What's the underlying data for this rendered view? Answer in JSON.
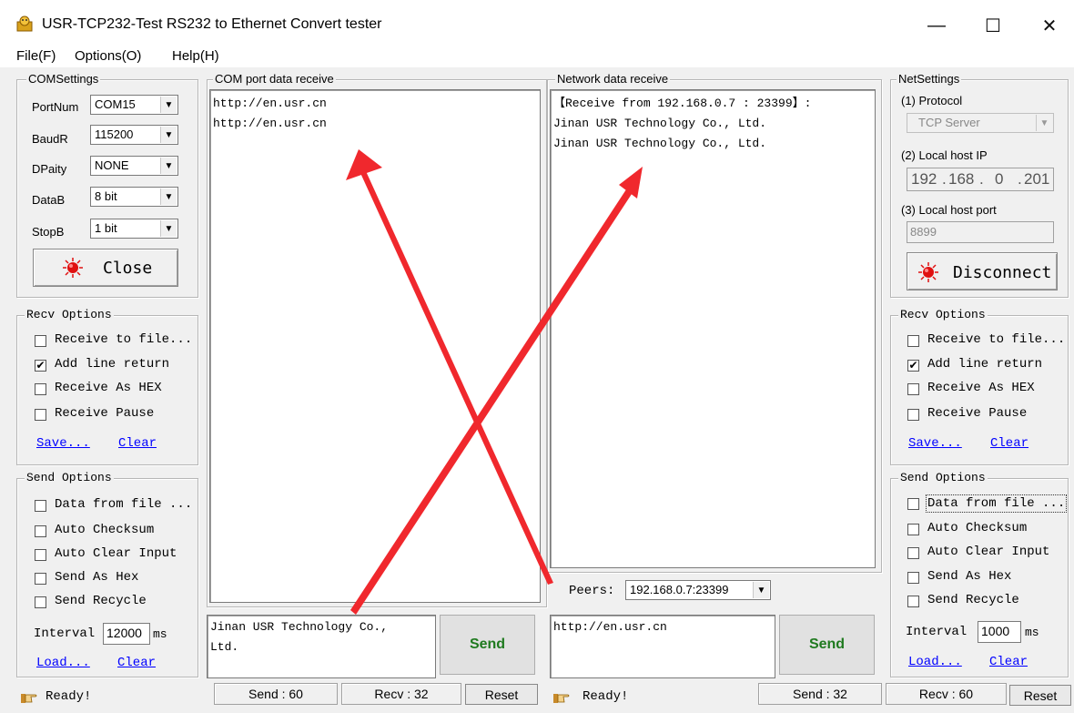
{
  "window": {
    "title": "USR-TCP232-Test  RS232 to Ethernet Convert tester",
    "minimize": "—",
    "maximize": "☐",
    "close": "✕"
  },
  "menu": [
    "File(F)",
    "Options(O)",
    "Help(H)"
  ],
  "com_settings": {
    "title": "COMSettings",
    "fields": [
      {
        "label": "PortNum",
        "value": "COM15"
      },
      {
        "label": "BaudR",
        "value": "115200"
      },
      {
        "label": "DPaity",
        "value": "NONE"
      },
      {
        "label": "DataB",
        "value": "8 bit"
      },
      {
        "label": "StopB",
        "value": "1 bit"
      }
    ],
    "close_button": "Close"
  },
  "left_recv_options": {
    "title": "Recv Options",
    "items": [
      {
        "label": "Receive to file...",
        "checked": false
      },
      {
        "label": "Add line return",
        "checked": true
      },
      {
        "label": "Receive As HEX",
        "checked": false
      },
      {
        "label": "Receive Pause",
        "checked": false
      }
    ],
    "save": "Save...",
    "clear": "Clear"
  },
  "left_send_options": {
    "title": "Send Options",
    "items": [
      {
        "label": "Data from file ...",
        "checked": false
      },
      {
        "label": "Auto Checksum",
        "checked": false
      },
      {
        "label": "Auto Clear Input",
        "checked": false
      },
      {
        "label": "Send As Hex",
        "checked": false
      },
      {
        "label": "Send Recycle",
        "checked": false
      }
    ],
    "interval_label": "Interval",
    "interval_value": "12000",
    "interval_unit": "ms",
    "load": "Load...",
    "clear": "Clear"
  },
  "com_receive": {
    "title": "COM port data receive",
    "lines": [
      "http://en.usr.cn",
      "http://en.usr.cn"
    ]
  },
  "com_send": {
    "lines": [
      "Jinan USR Technology Co.,",
      "Ltd."
    ],
    "send_button": "Send"
  },
  "net_receive": {
    "title": "Network data receive",
    "lines": [
      "【Receive from 192.168.0.7 : 23399】:",
      "Jinan USR Technology Co., Ltd.",
      "Jinan USR Technology Co., Ltd."
    ]
  },
  "peers": {
    "label": "Peers:",
    "value": "192.168.0.7:23399"
  },
  "net_send": {
    "lines": [
      "http://en.usr.cn"
    ],
    "send_button": "Send"
  },
  "net_settings": {
    "title": "NetSettings",
    "protocol_label": "(1) Protocol",
    "protocol_value": "TCP Server",
    "ip_label": "(2) Local host IP",
    "ip_parts": [
      "192",
      "168",
      "0",
      "201"
    ],
    "port_label": "(3) Local host port",
    "port_value": "8899",
    "disconnect_button": "Disconnect"
  },
  "right_recv_options": {
    "title": "Recv Options",
    "items": [
      {
        "label": "Receive to file...",
        "checked": false
      },
      {
        "label": "Add line return",
        "checked": true
      },
      {
        "label": "Receive As HEX",
        "checked": false
      },
      {
        "label": "Receive Pause",
        "checked": false
      }
    ],
    "save": "Save...",
    "clear": "Clear"
  },
  "right_send_options": {
    "title": "Send Options",
    "items": [
      {
        "label": "Data from file ...",
        "checked": false
      },
      {
        "label": "Auto Checksum",
        "checked": false
      },
      {
        "label": "Auto Clear Input",
        "checked": false
      },
      {
        "label": "Send As Hex",
        "checked": false
      },
      {
        "label": "Send Recycle",
        "checked": false
      }
    ],
    "interval_label": "Interval",
    "interval_value": "1000",
    "interval_unit": "ms",
    "load": "Load...",
    "clear": "Clear"
  },
  "status_left": {
    "ready": "Ready!",
    "send": "Send : 60",
    "recv": "Recv : 32",
    "reset": "Reset"
  },
  "status_right": {
    "ready": "Ready!",
    "send": "Send : 32",
    "recv": "Recv : 60",
    "reset": "Reset"
  },
  "colors": {
    "annotation_arrow": "#f0282d",
    "send_text": "#1f7a1f",
    "link": "#0000ff",
    "led": "#e01010"
  }
}
